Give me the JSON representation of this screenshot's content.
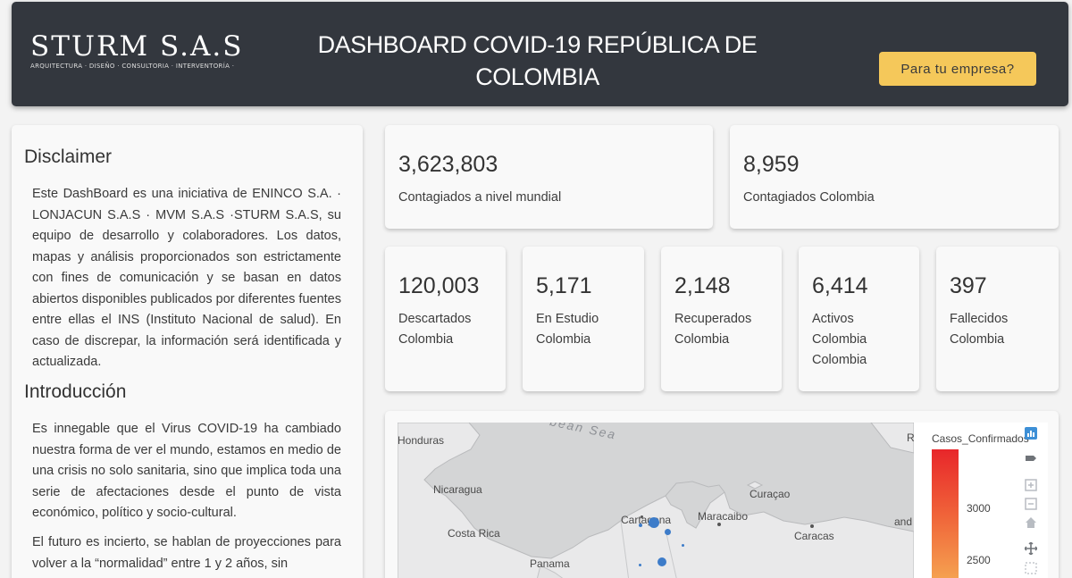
{
  "header": {
    "logo_name": "STURM S.A.S",
    "logo_tagline": "ARQUITECTURA · DISEÑO · CONSULTORIA · INTERVENTORÍA ·",
    "title": "DASHBOARD COVID-19 REPÚBLICA DE COLOMBIA",
    "cta_label": "Para tu empresa?"
  },
  "sidebar": {
    "disclaimer_title": "Disclaimer",
    "disclaimer_text": "Este DashBoard es una iniciativa de ENINCO S.A. · LONJACUN S.A.S · MVM S.A.S ·STURM S.A.S, su equipo de desarrollo y colaboradores. Los datos, mapas y análisis proporcionados son estrictamente con fines de comunicación y se basan en datos abiertos disponibles publicados por diferentes fuentes entre ellas el INS (Instituto Nacional de salud). En caso de discrepar, la información será identificada y actualizada.",
    "intro_title": "Introducción",
    "intro_p1": "Es innegable que el Virus COVID-19 ha cambiado nuestra forma de ver el mundo, estamos en medio de una crisis no solo sanitaria, sino que implica toda una serie de afectaciones desde el punto de vista económico, político y socio-cultural.",
    "intro_p2": "El futuro es incierto, se hablan de proyecciones para volver a la “normalidad” entre 1 y 2 años, sin"
  },
  "stats_top": [
    {
      "value": "3,623,803",
      "label": "Contagiados a nivel mundial"
    },
    {
      "value": "8,959",
      "label": "Contagiados Colombia"
    }
  ],
  "stats": [
    {
      "value": "120,003",
      "label": "Descartados Colombia"
    },
    {
      "value": "5,171",
      "label": "En Estudio Colombia"
    },
    {
      "value": "2,148",
      "label": "Recuperados Colombia"
    },
    {
      "value": "6,414",
      "label": "Activos Colombia Colombia"
    },
    {
      "value": "397",
      "label": "Fallecidos Colombia"
    }
  ],
  "map": {
    "labels": {
      "sea": "bean Sea",
      "honduras": "Honduras",
      "nicaragua": "Nicaragua",
      "costa_rica": "Costa Rica",
      "panama": "Panama",
      "cartagena": "Cartagena",
      "maracaibo": "Maracaibo",
      "curacao": "Curaçao",
      "caracas": "Caracas",
      "edge_r": "R",
      "edge_and": "and"
    },
    "legend_title": "Casos_Confirmados",
    "ticks": [
      "3000",
      "2500"
    ],
    "colors": {
      "high": "#e8262a",
      "low": "#f7b55a",
      "marker": "#3d7cc9"
    },
    "toolbar_icons": [
      "plotly-logo-icon",
      "select-box-icon",
      "zoom-in-icon",
      "zoom-out-icon",
      "reset-home-icon",
      "pan-icon",
      "lasso-select-icon"
    ]
  }
}
